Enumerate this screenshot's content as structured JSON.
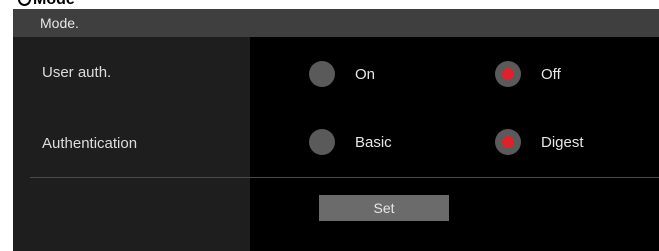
{
  "section_heading": "Mode",
  "panel": {
    "title": "Mode."
  },
  "rows": [
    {
      "label": "User auth.",
      "options": [
        {
          "label": "On",
          "selected": false
        },
        {
          "label": "Off",
          "selected": true
        }
      ]
    },
    {
      "label": "Authentication",
      "options": [
        {
          "label": "Basic",
          "selected": false
        },
        {
          "label": "Digest",
          "selected": true
        }
      ]
    }
  ],
  "set_button_label": "Set",
  "colors": {
    "panel_bg": "#000000",
    "header_bg": "#3f3f3f",
    "label_column_bg": "#1e1e1e",
    "radio_unselected": "#5a5a5a",
    "radio_selected_dot": "#e0202a",
    "button_bg": "#6b6b6b"
  }
}
